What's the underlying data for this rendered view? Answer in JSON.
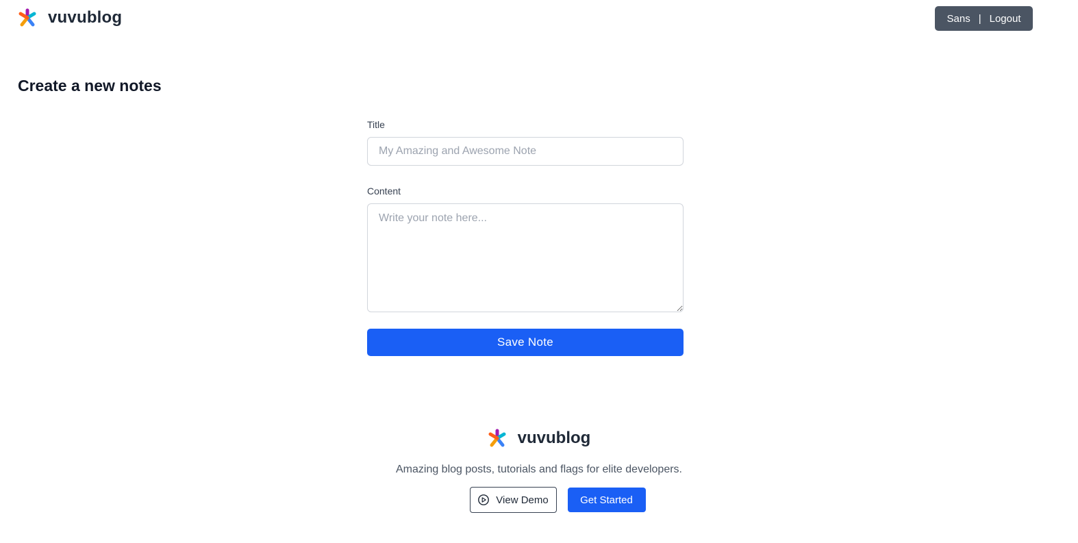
{
  "header": {
    "brand": "vuvublog",
    "user_name": "Sans",
    "separator": "|",
    "logout_label": "Logout",
    "logo_icon": "asterisk-logo-icon"
  },
  "main": {
    "page_title": "Create a new notes",
    "form": {
      "title_label": "Title",
      "title_value": "",
      "title_placeholder": "My Amazing and Awesome Note",
      "content_label": "Content",
      "content_value": "",
      "content_placeholder": "Write your note here...",
      "save_label": "Save Note"
    }
  },
  "footer": {
    "brand": "vuvublog",
    "tagline": "Amazing blog posts, tutorials and flags for elite developers.",
    "view_demo_label": "View Demo",
    "get_started_label": "Get Started",
    "demo_icon": "play-circle-icon"
  },
  "colors": {
    "primary": "#1a5ff5",
    "user_menu_bg": "#4b5563",
    "text_dark": "#111827",
    "logo_colors": [
      "#ff5e1a",
      "#a21caf",
      "#06b6d4",
      "#3b82f6",
      "#f59e0b"
    ]
  }
}
